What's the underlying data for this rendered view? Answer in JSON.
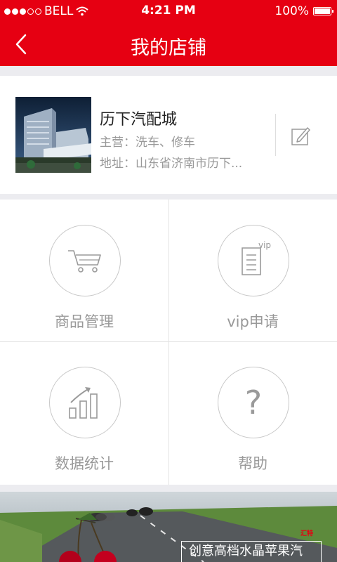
{
  "status_bar": {
    "carrier": "BELL",
    "time": "4:21 PM",
    "battery": "100%"
  },
  "nav": {
    "title": "我的店铺",
    "back_icon": "chevron-left-icon"
  },
  "store": {
    "name": "历下汽配城",
    "main_business": "主营：洗车、修车",
    "address": "地址：山东省济南市历下..."
  },
  "grid": {
    "items": [
      {
        "label": "商品管理",
        "icon": "cart-icon"
      },
      {
        "label": "vip申请",
        "icon": "vip-document-icon",
        "badge": "vip"
      },
      {
        "label": "数据统计",
        "icon": "bar-chart-icon"
      },
      {
        "label": "帮助",
        "icon": "question-icon",
        "glyph": "?"
      }
    ]
  },
  "banner": {
    "text": "创意高档水晶苹果汽",
    "brand": "汇特"
  },
  "colors": {
    "brand_red": "#e60012",
    "icon_gray": "#9a9a9a"
  }
}
